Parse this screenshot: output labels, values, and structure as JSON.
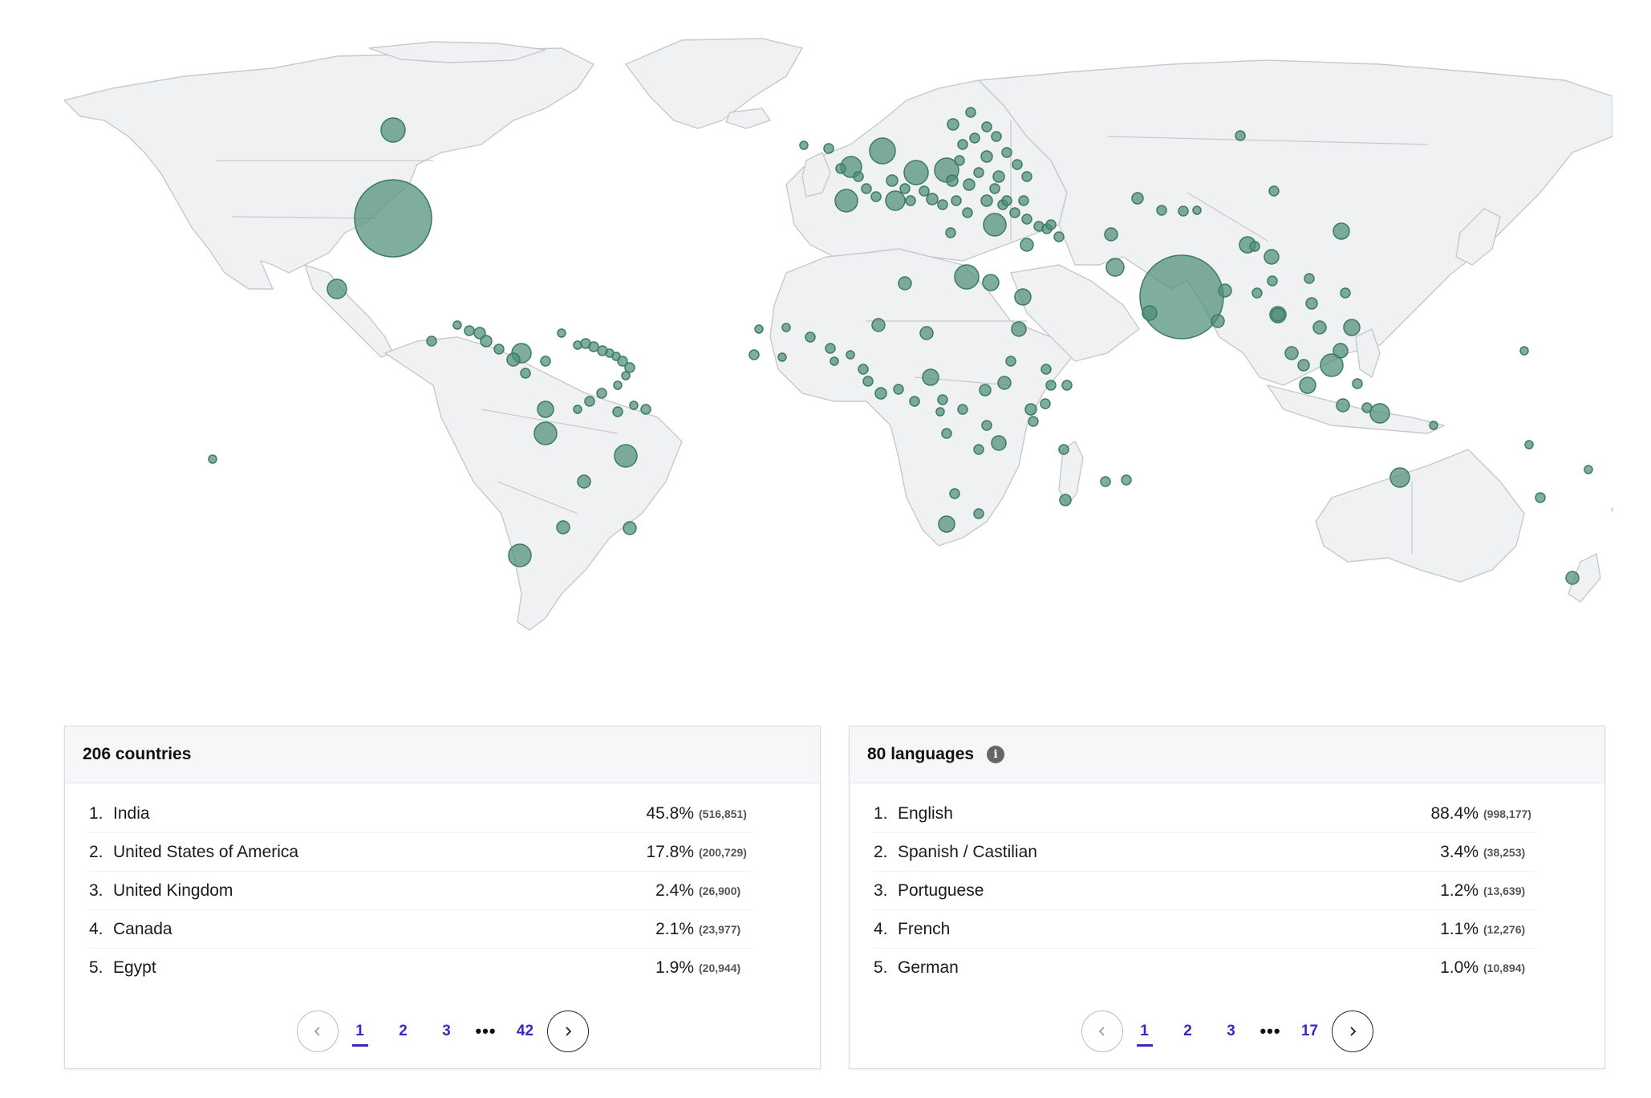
{
  "map": {
    "bubble_color": "#4e8f78",
    "land_color": "#f0f1f2",
    "border_color": "#c6c9cc"
  },
  "countries_panel": {
    "title": "206 countries",
    "rows": [
      {
        "rank": "1.",
        "name": "India",
        "percent": "45.8%",
        "count": "(516,851)"
      },
      {
        "rank": "2.",
        "name": "United States of America",
        "percent": "17.8%",
        "count": "(200,729)"
      },
      {
        "rank": "3.",
        "name": "United Kingdom",
        "percent": "2.4%",
        "count": "(26,900)"
      },
      {
        "rank": "4.",
        "name": "Canada",
        "percent": "2.1%",
        "count": "(23,977)"
      },
      {
        "rank": "5.",
        "name": "Egypt",
        "percent": "1.9%",
        "count": "(20,944)"
      }
    ],
    "pagination": {
      "prev_icon": "chevron-left-icon",
      "pages": [
        "1",
        "2",
        "3"
      ],
      "ellipsis": "•••",
      "last": "42",
      "current": "1",
      "next_icon": "chevron-right-icon"
    }
  },
  "languages_panel": {
    "title": "80 languages",
    "info_icon": "i",
    "rows": [
      {
        "rank": "1.",
        "name": "English",
        "percent": "88.4%",
        "count": "(998,177)"
      },
      {
        "rank": "2.",
        "name": "Spanish / Castilian",
        "percent": "3.4%",
        "count": "(38,253)"
      },
      {
        "rank": "3.",
        "name": "Portuguese",
        "percent": "1.2%",
        "count": "(13,639)"
      },
      {
        "rank": "4.",
        "name": "French",
        "percent": "1.1%",
        "count": "(12,276)"
      },
      {
        "rank": "5.",
        "name": "German",
        "percent": "1.0%",
        "count": "(10,894)"
      }
    ],
    "pagination": {
      "prev_icon": "chevron-left-icon",
      "pages": [
        "1",
        "2",
        "3"
      ],
      "ellipsis": "•••",
      "last": "17",
      "current": "1",
      "next_icon": "chevron-right-icon"
    }
  }
}
